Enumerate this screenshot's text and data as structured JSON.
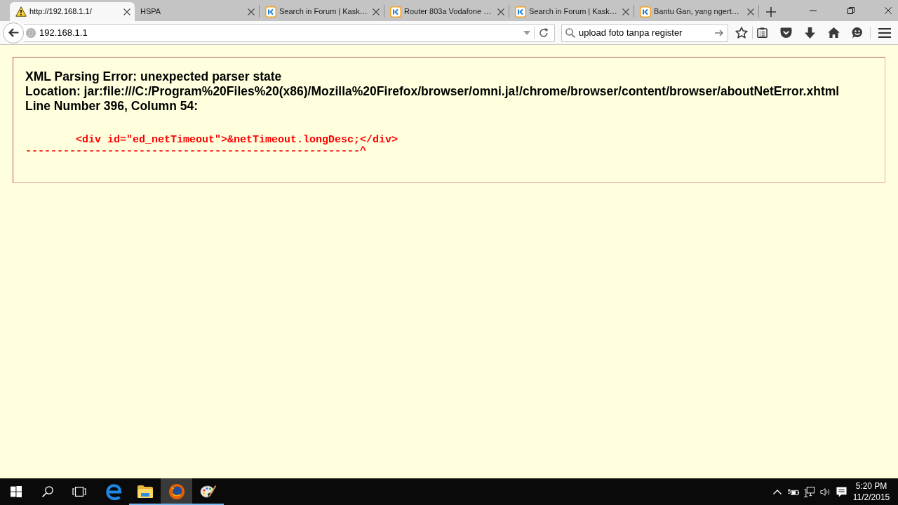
{
  "browser": {
    "tabs": [
      {
        "kind": "alert",
        "title": "http://192.168.1.1/",
        "selected": true
      },
      {
        "kind": "plain",
        "title": "HSPA",
        "selected": false
      },
      {
        "kind": "site",
        "title": "Search in Forum | Kask…",
        "selected": false
      },
      {
        "kind": "site",
        "title": "Router 803a Vodafone …",
        "selected": false
      },
      {
        "kind": "site",
        "title": "Search in Forum | Kask…",
        "selected": false
      },
      {
        "kind": "site",
        "title": "Bantu Gan, yang ngert…",
        "selected": false
      }
    ],
    "address_bar": {
      "value": "192.168.1.1"
    },
    "search_bar": {
      "value": "upload foto tanpa register"
    }
  },
  "page": {
    "error": {
      "title": "XML Parsing Error: unexpected parser state",
      "location": "Location: jar:file:///C:/Program%20Files%20(x86)/Mozilla%20Firefox/browser/omni.ja!/chrome/browser/content/browser/aboutNetError.xhtml",
      "line": "Line Number 396, Column 54:",
      "source_line": "\t<div id=\"ed_netTimeout\">&netTimeout.longDesc;</div>",
      "pointer": "-----------------------------------------------------^"
    }
  },
  "taskbar": {
    "apps": [
      {
        "kind": "edge",
        "running": false,
        "selected": false
      },
      {
        "kind": "explorer",
        "running": true,
        "selected": false
      },
      {
        "kind": "firefox",
        "running": true,
        "selected": true
      },
      {
        "kind": "paint",
        "running": true,
        "selected": false
      }
    ],
    "clock": {
      "time": "5:20 PM",
      "date": "11/2/2015"
    }
  }
}
